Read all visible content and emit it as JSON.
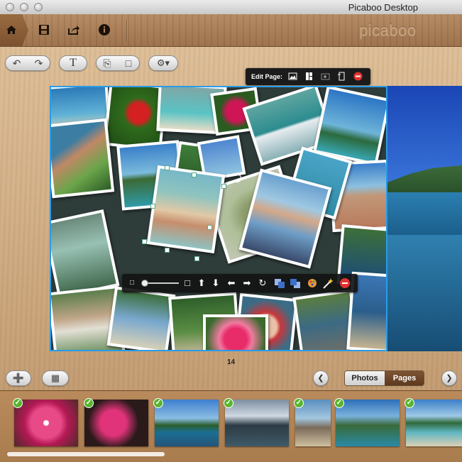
{
  "window": {
    "title": "Picaboo Desktop"
  },
  "toolbar": {
    "brand": "picaboo",
    "icons": [
      "home-icon",
      "save-icon",
      "share-icon",
      "info-icon"
    ]
  },
  "edit_page": {
    "label": "Edit Page:",
    "icons": [
      "background-icon",
      "layout-icon",
      "photo-edit-icon",
      "add-page-icon",
      "delete-icon"
    ]
  },
  "secondary_toolbar": {
    "text_button": "T"
  },
  "page": {
    "number": "14"
  },
  "view_toggle": {
    "photos": "Photos",
    "pages": "Pages"
  },
  "photo_tools": {
    "icons": [
      "zoom-out-icon",
      "zoom-slider",
      "zoom-in-icon",
      "move-up-icon",
      "move-down-icon",
      "move-left-icon",
      "move-right-icon",
      "rotate-icon",
      "send-back-icon",
      "bring-front-icon",
      "effects-icon",
      "magic-wand-icon",
      "remove-icon"
    ]
  },
  "filmstrip": {
    "count": 7
  },
  "colors": {
    "accent": "#2b9be6",
    "check": "#58b52e",
    "delete": "#e2312f",
    "pages_active": "#6b4528"
  }
}
